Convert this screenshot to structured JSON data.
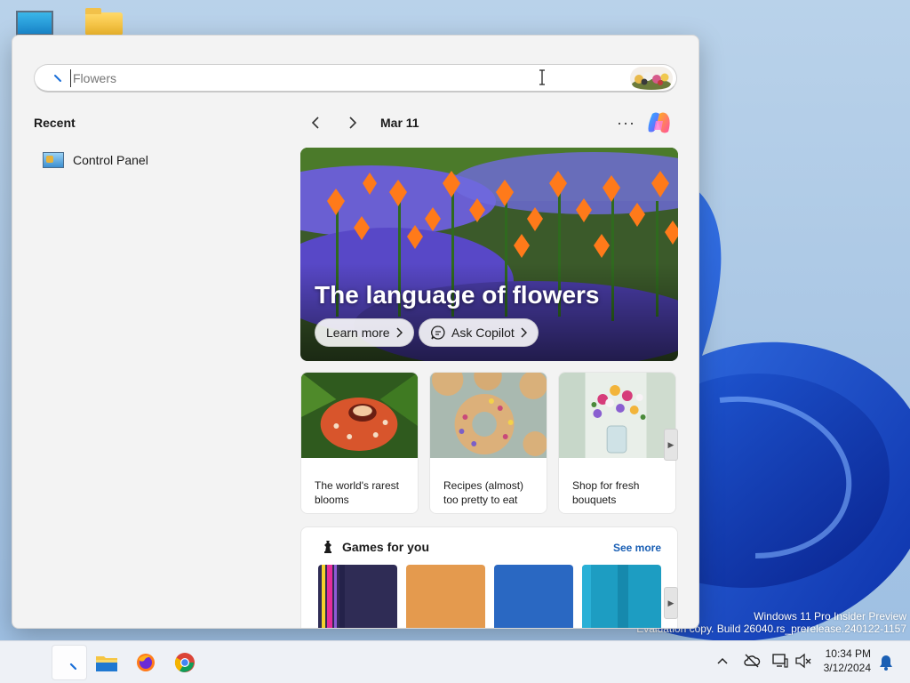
{
  "desktop": {
    "watermark_line1": "Windows 11 Pro Insider Preview",
    "watermark_line2": "Evaluation copy. Build 26040.rs_prerelease.240122-1157"
  },
  "search": {
    "value": "Flowers",
    "placeholder": "Flowers"
  },
  "recent": {
    "title": "Recent",
    "items": [
      {
        "label": "Control Panel",
        "icon": "control-panel-icon"
      }
    ]
  },
  "highlights": {
    "date": "Mar 11",
    "hero": {
      "title": "The language of flowers",
      "learn_more": "Learn more",
      "ask_copilot": "Ask Copilot"
    },
    "cards": [
      {
        "caption": "The world's rarest blooms"
      },
      {
        "caption": "Recipes (almost) too pretty to eat"
      },
      {
        "caption": "Shop for fresh bouquets"
      }
    ],
    "games": {
      "title": "Games for you",
      "see_more": "See more"
    }
  },
  "taskbar": {
    "apps": [
      "search",
      "file-explorer",
      "firefox",
      "chrome"
    ],
    "time": "10:34 PM",
    "date": "3/12/2024"
  }
}
